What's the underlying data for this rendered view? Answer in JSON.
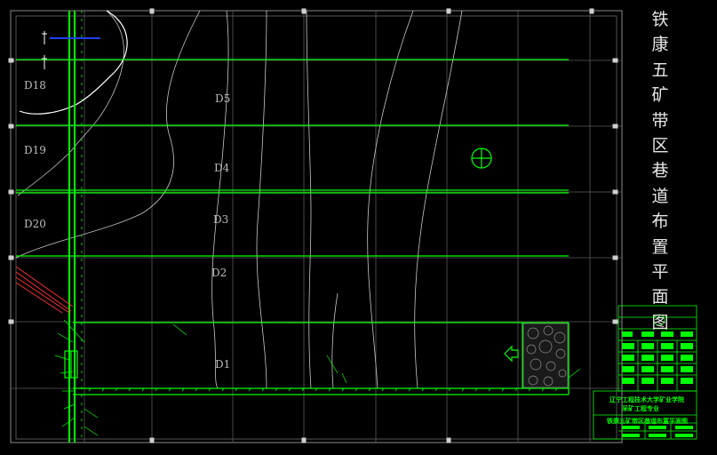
{
  "drawing": {
    "title_chars": [
      "铁",
      "康",
      "五",
      "矿",
      "带",
      "区",
      "巷",
      "道",
      "布",
      "置",
      "平",
      "面",
      "图"
    ],
    "block_labels": [
      "D18",
      "D19",
      "D20",
      "D5",
      "D4",
      "D3",
      "D2",
      "D1"
    ],
    "titleblock": {
      "line1": "辽宁工程技术大学矿业学院",
      "line2": "采矿工程专业",
      "drawing_name": "铁康五矿带区巷道布置平面图"
    },
    "colors": {
      "background": "#000000",
      "primary": "#00ff00",
      "grid": "#8a8a8a",
      "contour": "#c8c8c8",
      "accent_red": "#ff3030",
      "accent_blue": "#2040ff"
    }
  }
}
